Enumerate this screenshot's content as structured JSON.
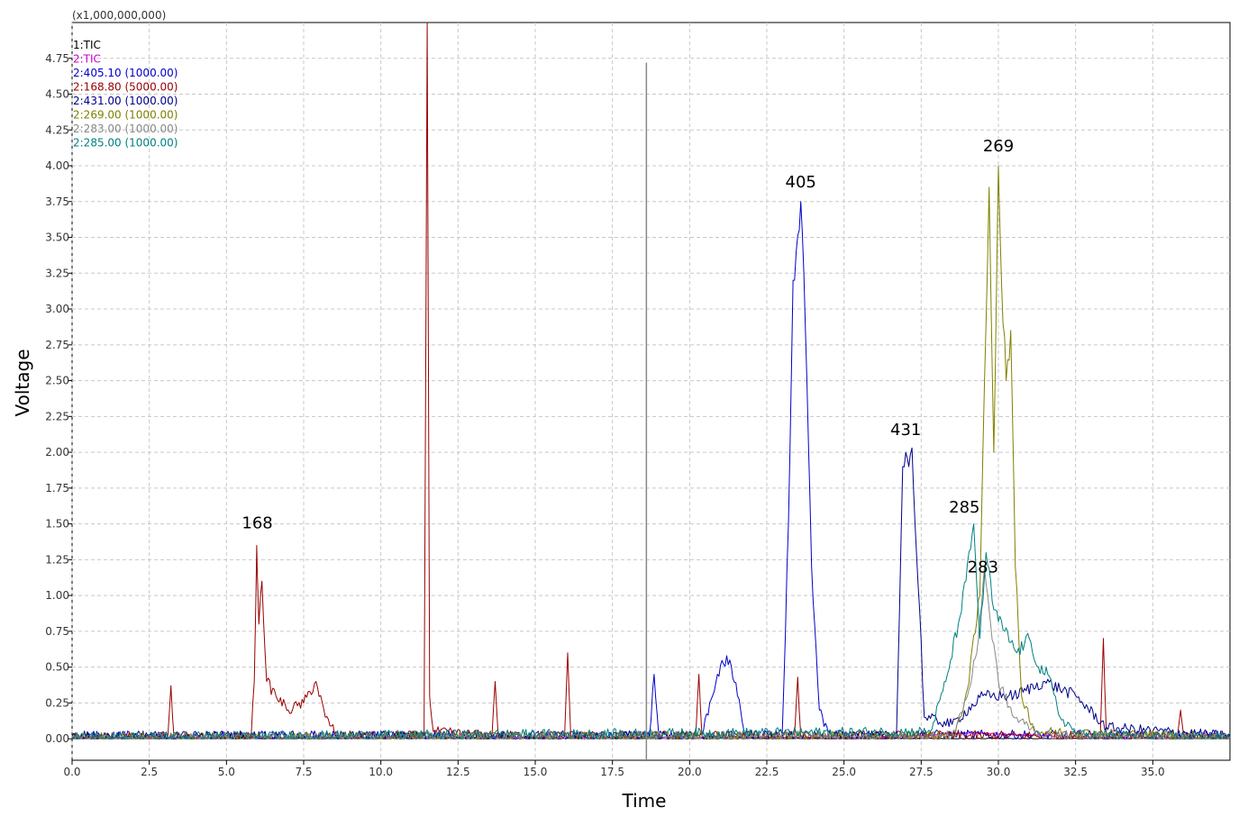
{
  "chart_data": {
    "type": "line",
    "multiplier_label": "(x1,000,000,000)",
    "xlabel": "Time",
    "ylabel": "Voltage",
    "xlim": [
      0,
      37.5
    ],
    "ylim": [
      -0.15,
      5.0
    ],
    "grid": true,
    "legend_position": "top-left",
    "x_ticks": [
      "0.0",
      "2.5",
      "5.0",
      "7.5",
      "10.0",
      "12.5",
      "15.0",
      "17.5",
      "20.0",
      "22.5",
      "25.0",
      "27.5",
      "30.0",
      "32.5",
      "35.0"
    ],
    "x_tick_values": [
      0,
      2.5,
      5,
      7.5,
      10,
      12.5,
      15,
      17.5,
      20,
      22.5,
      25,
      27.5,
      30,
      32.5,
      35
    ],
    "y_ticks": [
      "0.00",
      "0.25",
      "0.50",
      "0.75",
      "1.00",
      "1.25",
      "1.50",
      "1.75",
      "2.00",
      "2.25",
      "2.50",
      "2.75",
      "3.00",
      "3.25",
      "3.50",
      "3.75",
      "4.00",
      "4.25",
      "4.50",
      "4.75"
    ],
    "y_tick_values": [
      0,
      0.25,
      0.5,
      0.75,
      1.0,
      1.25,
      1.5,
      1.75,
      2.0,
      2.25,
      2.5,
      2.75,
      3.0,
      3.25,
      3.5,
      3.75,
      4.0,
      4.25,
      4.5,
      4.75
    ],
    "marker_line": {
      "x": 18.6,
      "y_top": 4.72,
      "color": "#888888"
    },
    "series": [
      {
        "name": "1:TIC",
        "color": "#000000",
        "points": [
          [
            0,
            0
          ],
          [
            37.5,
            0
          ]
        ]
      },
      {
        "name": "2:TIC",
        "color": "#cc00cc",
        "points": [
          [
            0,
            0.01
          ],
          [
            26.5,
            0.01
          ],
          [
            27.5,
            0.02
          ],
          [
            28.5,
            0.04
          ],
          [
            29.5,
            0.04
          ],
          [
            30.5,
            0.03
          ],
          [
            31.5,
            0.02
          ],
          [
            33.5,
            0.01
          ],
          [
            37.5,
            0.01
          ]
        ]
      },
      {
        "name": "2:405.10 (1000.00)",
        "color": "#0000cc",
        "points": [
          [
            0,
            0.02
          ],
          [
            18.7,
            0.02
          ],
          [
            18.85,
            0.45
          ],
          [
            19.0,
            0.02
          ],
          [
            20.4,
            0.03
          ],
          [
            20.9,
            0.45
          ],
          [
            21.1,
            0.52
          ],
          [
            21.3,
            0.55
          ],
          [
            21.55,
            0.3
          ],
          [
            21.8,
            0.03
          ],
          [
            23.0,
            0.03
          ],
          [
            23.2,
            1.5
          ],
          [
            23.35,
            3.2
          ],
          [
            23.45,
            3.4
          ],
          [
            23.55,
            3.55
          ],
          [
            23.6,
            3.75
          ],
          [
            23.7,
            3.25
          ],
          [
            23.8,
            2.5
          ],
          [
            23.95,
            1.2
          ],
          [
            24.2,
            0.2
          ],
          [
            24.5,
            0.03
          ],
          [
            37.5,
            0.02
          ]
        ]
      },
      {
        "name": "2:168.80 (5000.00)",
        "color": "#990000",
        "points": [
          [
            0,
            0.01
          ],
          [
            3.1,
            0.01
          ],
          [
            3.2,
            0.37
          ],
          [
            3.3,
            0.01
          ],
          [
            5.8,
            0.01
          ],
          [
            5.9,
            0.4
          ],
          [
            5.98,
            1.35
          ],
          [
            6.05,
            0.8
          ],
          [
            6.15,
            1.1
          ],
          [
            6.3,
            0.4
          ],
          [
            6.6,
            0.3
          ],
          [
            7.0,
            0.2
          ],
          [
            7.5,
            0.25
          ],
          [
            7.9,
            0.4
          ],
          [
            8.2,
            0.15
          ],
          [
            8.6,
            0.02
          ],
          [
            11.4,
            0.02
          ],
          [
            11.45,
            2.5
          ],
          [
            11.5,
            5.0
          ],
          [
            11.58,
            0.3
          ],
          [
            11.7,
            0.05
          ],
          [
            13.6,
            0.02
          ],
          [
            13.7,
            0.4
          ],
          [
            13.8,
            0.02
          ],
          [
            15.95,
            0.02
          ],
          [
            16.05,
            0.6
          ],
          [
            16.15,
            0.02
          ],
          [
            20.2,
            0.02
          ],
          [
            20.3,
            0.45
          ],
          [
            20.4,
            0.02
          ],
          [
            23.4,
            0.02
          ],
          [
            23.5,
            0.43
          ],
          [
            23.6,
            0.02
          ],
          [
            33.3,
            0.02
          ],
          [
            33.4,
            0.7
          ],
          [
            33.5,
            0.02
          ],
          [
            35.8,
            0.02
          ],
          [
            35.9,
            0.2
          ],
          [
            36.0,
            0.02
          ],
          [
            37.5,
            0.01
          ]
        ]
      },
      {
        "name": "2:431.00 (1000.00)",
        "color": "#000088",
        "points": [
          [
            0,
            0.02
          ],
          [
            26.7,
            0.02
          ],
          [
            26.9,
            1.9
          ],
          [
            27.0,
            2.0
          ],
          [
            27.1,
            1.9
          ],
          [
            27.2,
            2.03
          ],
          [
            27.3,
            1.5
          ],
          [
            27.45,
            0.9
          ],
          [
            27.6,
            0.15
          ],
          [
            28.5,
            0.1
          ],
          [
            29.5,
            0.3
          ],
          [
            30.5,
            0.3
          ],
          [
            31.5,
            0.4
          ],
          [
            32.5,
            0.3
          ],
          [
            33.5,
            0.08
          ],
          [
            37.5,
            0.02
          ]
        ]
      },
      {
        "name": "2:269.00 (1000.00)",
        "color": "#808000",
        "points": [
          [
            0,
            0.01
          ],
          [
            28.6,
            0.02
          ],
          [
            29.0,
            0.35
          ],
          [
            29.4,
            1.0
          ],
          [
            29.55,
            2.5
          ],
          [
            29.7,
            3.85
          ],
          [
            29.85,
            2.0
          ],
          [
            30.0,
            4.0
          ],
          [
            30.1,
            3.2
          ],
          [
            30.25,
            2.5
          ],
          [
            30.4,
            2.85
          ],
          [
            30.55,
            1.2
          ],
          [
            30.75,
            0.3
          ],
          [
            31.2,
            0.05
          ],
          [
            37.5,
            0.01
          ]
        ]
      },
      {
        "name": "2:283.00 (1000.00)",
        "color": "#888888",
        "points": [
          [
            0,
            0.01
          ],
          [
            28.5,
            0.02
          ],
          [
            29.0,
            0.3
          ],
          [
            29.3,
            0.6
          ],
          [
            29.55,
            1.2
          ],
          [
            29.75,
            0.8
          ],
          [
            30.0,
            0.4
          ],
          [
            30.5,
            0.15
          ],
          [
            31.5,
            0.02
          ],
          [
            37.5,
            0.01
          ]
        ]
      },
      {
        "name": "2:285.00 (1000.00)",
        "color": "#008080",
        "points": [
          [
            0,
            0.01
          ],
          [
            27.8,
            0.05
          ],
          [
            28.3,
            0.4
          ],
          [
            28.7,
            0.8
          ],
          [
            28.95,
            1.1
          ],
          [
            29.2,
            1.5
          ],
          [
            29.4,
            0.7
          ],
          [
            29.6,
            1.3
          ],
          [
            29.85,
            0.9
          ],
          [
            30.2,
            0.75
          ],
          [
            30.6,
            0.6
          ],
          [
            31.0,
            0.7
          ],
          [
            31.3,
            0.5
          ],
          [
            31.6,
            0.45
          ],
          [
            32.0,
            0.15
          ],
          [
            32.6,
            0.03
          ],
          [
            37.5,
            0.01
          ]
        ]
      }
    ],
    "annotations": [
      {
        "text": "168",
        "x": 6.0,
        "y": 1.47
      },
      {
        "text": "405",
        "x": 23.6,
        "y": 3.85
      },
      {
        "text": "431",
        "x": 27.0,
        "y": 2.12
      },
      {
        "text": "269",
        "x": 30.0,
        "y": 4.1
      },
      {
        "text": "285",
        "x": 28.9,
        "y": 1.58
      },
      {
        "text": "283",
        "x": 29.5,
        "y": 1.16
      }
    ]
  }
}
